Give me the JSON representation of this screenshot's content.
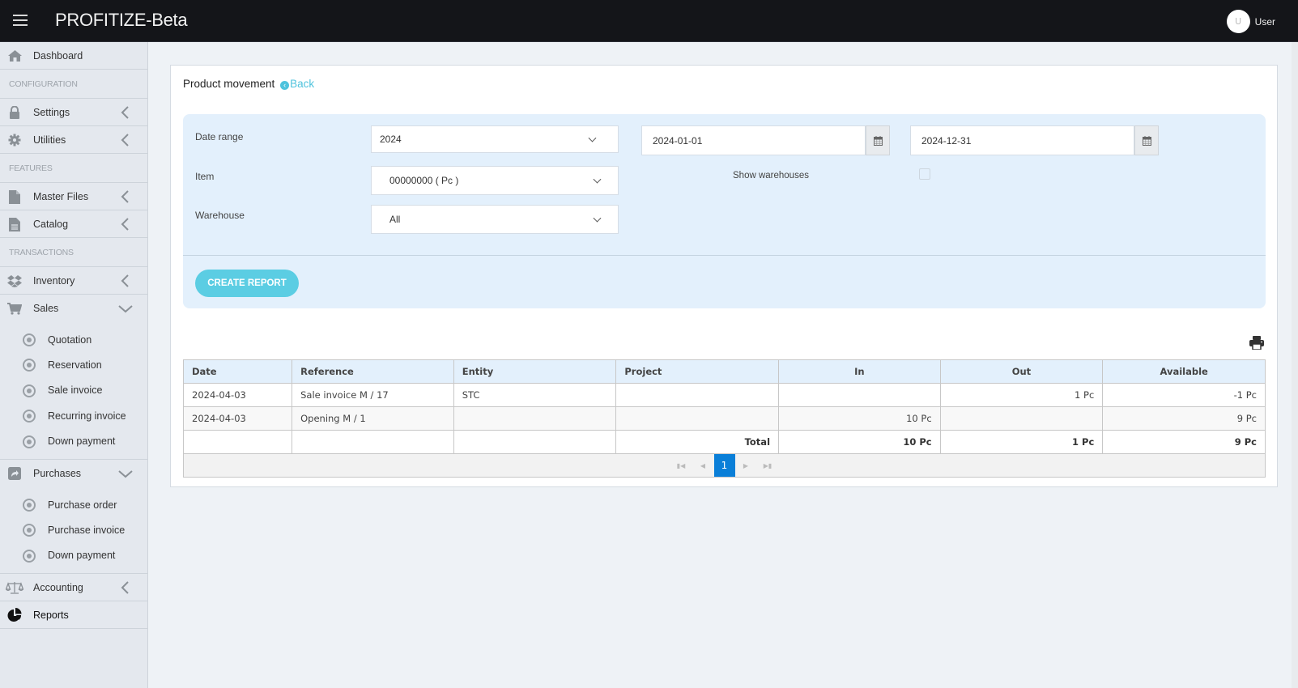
{
  "app": {
    "title": "PROFITIZE-Beta",
    "user": {
      "initial": "U",
      "name": "User"
    }
  },
  "sidebar": {
    "dashboard": "Dashboard",
    "sections": {
      "configuration": "CONFIGURATION",
      "features": "FEATURES",
      "transactions": "TRANSACTIONS"
    },
    "settings": "Settings",
    "utilities": "Utilities",
    "master_files": "Master Files",
    "catalog": "Catalog",
    "inventory": "Inventory",
    "sales": {
      "label": "Sales",
      "items": [
        "Quotation",
        "Reservation",
        "Sale invoice",
        "Recurring invoice",
        "Down payment"
      ]
    },
    "purchases": {
      "label": "Purchases",
      "items": [
        "Purchase order",
        "Purchase invoice",
        "Down payment"
      ]
    },
    "accounting": "Accounting",
    "reports": "Reports"
  },
  "page": {
    "title": "Product movement",
    "back_label": "Back",
    "back_icon": "arrow-circle-left-icon"
  },
  "filters": {
    "date_range_label": "Date range",
    "date_range_value": "2024",
    "date_from": "2024-01-01",
    "date_to": "2024-12-31",
    "item_label": "Item",
    "item_value": "00000000 ( Pc )",
    "show_warehouses_label": "Show warehouses",
    "show_warehouses_checked": false,
    "warehouse_label": "Warehouse",
    "warehouse_value": "All",
    "create_report": "CREATE REPORT"
  },
  "table": {
    "columns": [
      "Date",
      "Reference",
      "Entity",
      "Project",
      "In",
      "Out",
      "Available"
    ],
    "rows": [
      {
        "date": "2024-04-03",
        "reference": "Sale invoice M / 17",
        "entity": "STC",
        "project": "",
        "in": "",
        "out": "1 Pc",
        "available": "-1 Pc"
      },
      {
        "date": "2024-04-03",
        "reference": "Opening M / 1",
        "entity": "",
        "project": "",
        "in": "10 Pc",
        "out": "",
        "available": "9 Pc"
      }
    ],
    "total": {
      "label": "Total",
      "in": "10 Pc",
      "out": "1 Pc",
      "available": "9 Pc"
    },
    "pagination": {
      "current_page": "1"
    }
  },
  "colors": {
    "accent": "#4fc3dd",
    "button": "#5bcde3",
    "topbar": "#141519",
    "page_active": "#0a7fd8"
  }
}
